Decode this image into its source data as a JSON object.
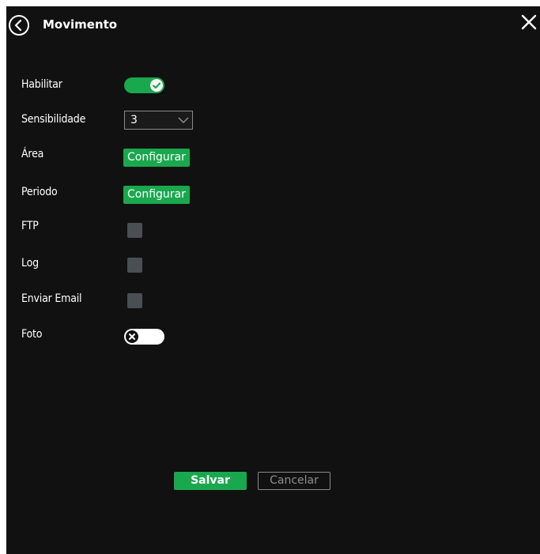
{
  "header": {
    "title": "Movimento",
    "back_icon": "back-circle-arrow-icon",
    "close_icon": "close-x-icon"
  },
  "form": {
    "habilitar": {
      "label": "Habilitar",
      "enabled": true
    },
    "sensibilidade": {
      "label": "Sensibilidade",
      "value": "3",
      "icon": "chevron-down-icon"
    },
    "area": {
      "label": "Área",
      "button": "Configurar"
    },
    "periodo": {
      "label": "Periodo",
      "button": "Configurar"
    },
    "ftp": {
      "label": "FTP",
      "checked": false
    },
    "log": {
      "label": "Log",
      "checked": false
    },
    "enviar_email": {
      "label": "Enviar Email",
      "checked": false
    },
    "foto": {
      "label": "Foto",
      "enabled": false
    }
  },
  "footer": {
    "save_label": "Salvar",
    "cancel_label": "Cancelar"
  },
  "colors": {
    "background": "#111111",
    "accent": "#1aa84f",
    "checkbox": "#4a4f54",
    "cancel_border": "#8a8a8a"
  }
}
